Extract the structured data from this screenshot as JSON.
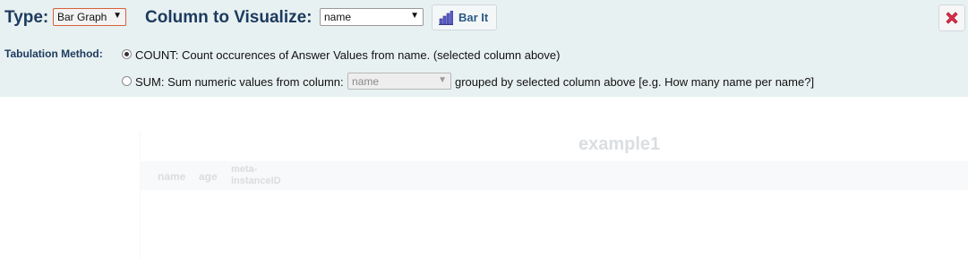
{
  "panel": {
    "type_label": "Type:",
    "type_select_value": "Bar Graph",
    "column_label": "Column to Visualize:",
    "column_select_value": "name",
    "bar_it_label": "Bar It",
    "tabulation_label": "Tabulation Method:",
    "count_option_text": "COUNT: Count occurences of Answer Values from name. (selected column above)",
    "count_selected": true,
    "sum_option_prefix": "SUM: Sum numeric values from column:",
    "sum_select_value": "name",
    "sum_option_suffix": "grouped by selected column above [e.g. How many name per name?]",
    "sum_selected": false,
    "caret": "▼",
    "accent_color": "#1c3a5e",
    "close_icon_color": "#e0304a"
  },
  "background": {
    "dataset_title": "example1",
    "columns": [
      "name",
      "age",
      "meta-\ninstanceID"
    ]
  }
}
